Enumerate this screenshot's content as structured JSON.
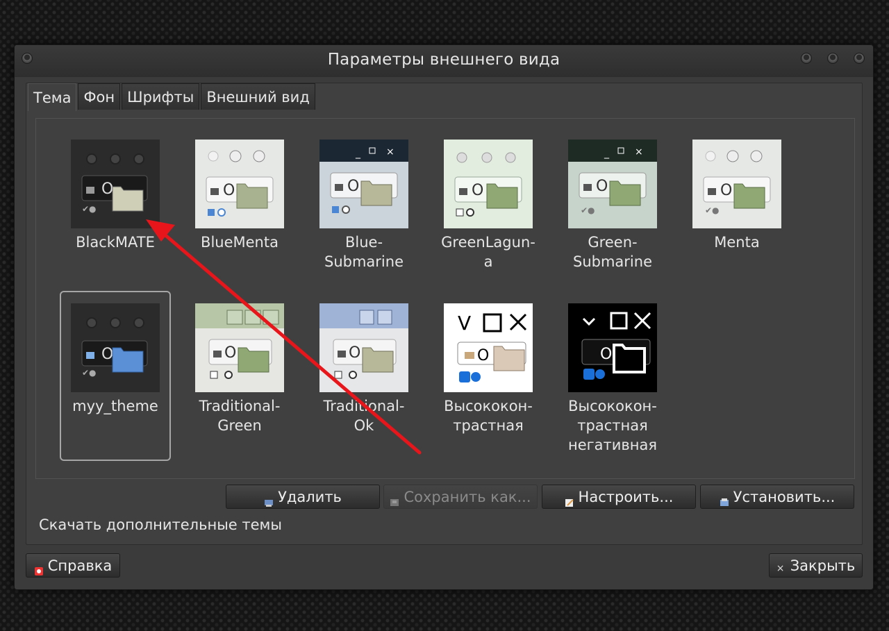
{
  "window": {
    "title": "Параметры внешнего вида"
  },
  "tabs": [
    {
      "label": "Тема",
      "active": true
    },
    {
      "label": "Фон",
      "active": false
    },
    {
      "label": "Шрифты",
      "active": false
    },
    {
      "label": "Внешний вид",
      "active": false
    }
  ],
  "themes": [
    {
      "label": "BlackMATE",
      "selected": false
    },
    {
      "label": "BlueMenta",
      "selected": false
    },
    {
      "label": "Blue-\nSubmarine",
      "selected": false
    },
    {
      "label": "GreenLagun-\na",
      "selected": false
    },
    {
      "label": "Green-\nSubmarine",
      "selected": false
    },
    {
      "label": "Menta",
      "selected": false
    },
    {
      "label": "myy_theme",
      "selected": true
    },
    {
      "label": "Traditional-\nGreen",
      "selected": false
    },
    {
      "label": "Traditional-\nOk",
      "selected": false
    },
    {
      "label": "Высококон-\nтрастная",
      "selected": false
    },
    {
      "label": "Высококон-\nтрастная\nнегативная",
      "selected": false
    }
  ],
  "actions": {
    "delete": "Удалить",
    "save_as": "Сохранить как...",
    "customize": "Настроить...",
    "install": "Установить..."
  },
  "download_link": "Скачать дополнительные темы",
  "footer": {
    "help": "Справка",
    "close": "Закрыть"
  },
  "colors": {
    "annotation_arrow": "#e8161b",
    "selection": "#a6a6a6"
  }
}
